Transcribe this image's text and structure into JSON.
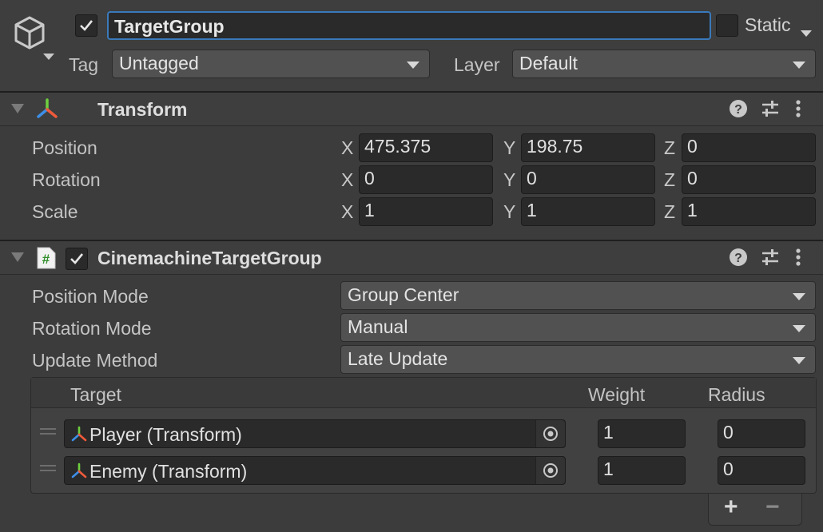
{
  "header": {
    "name": "TargetGroup",
    "active_checked": true,
    "static_label": "Static",
    "static_checked": false,
    "tag_label": "Tag",
    "tag_value": "Untagged",
    "layer_label": "Layer",
    "layer_value": "Default"
  },
  "transform": {
    "title": "Transform",
    "rows": [
      {
        "label": "Position",
        "x": "475.375",
        "y": "198.75",
        "z": "0"
      },
      {
        "label": "Rotation",
        "x": "0",
        "y": "0",
        "z": "0"
      },
      {
        "label": "Scale",
        "x": "1",
        "y": "1",
        "z": "1"
      }
    ],
    "axis_x": "X",
    "axis_y": "Y",
    "axis_z": "Z"
  },
  "target_group": {
    "title": "CinemachineTargetGroup",
    "enabled": true,
    "position_mode_label": "Position Mode",
    "position_mode_value": "Group Center",
    "rotation_mode_label": "Rotation Mode",
    "rotation_mode_value": "Manual",
    "update_method_label": "Update Method",
    "update_method_value": "Late Update",
    "columns": {
      "target": "Target",
      "weight": "Weight",
      "radius": "Radius"
    },
    "targets": [
      {
        "target": "Player (Transform)",
        "weight": "1",
        "radius": "0"
      },
      {
        "target": "Enemy (Transform)",
        "weight": "1",
        "radius": "0"
      }
    ],
    "add_symbol": "+",
    "remove_symbol": "−"
  },
  "colors": {
    "background": "#3c3c3c",
    "accent_focus": "#3a79bb",
    "field": "#2a2a2a",
    "script_icon_green": "#5fb64a"
  },
  "icons": [
    "gameobject-cube-icon",
    "transform-axes-icon",
    "csharp-script-icon",
    "help-icon",
    "presets-icon",
    "kebab-menu-icon",
    "object-picker-icon"
  ]
}
